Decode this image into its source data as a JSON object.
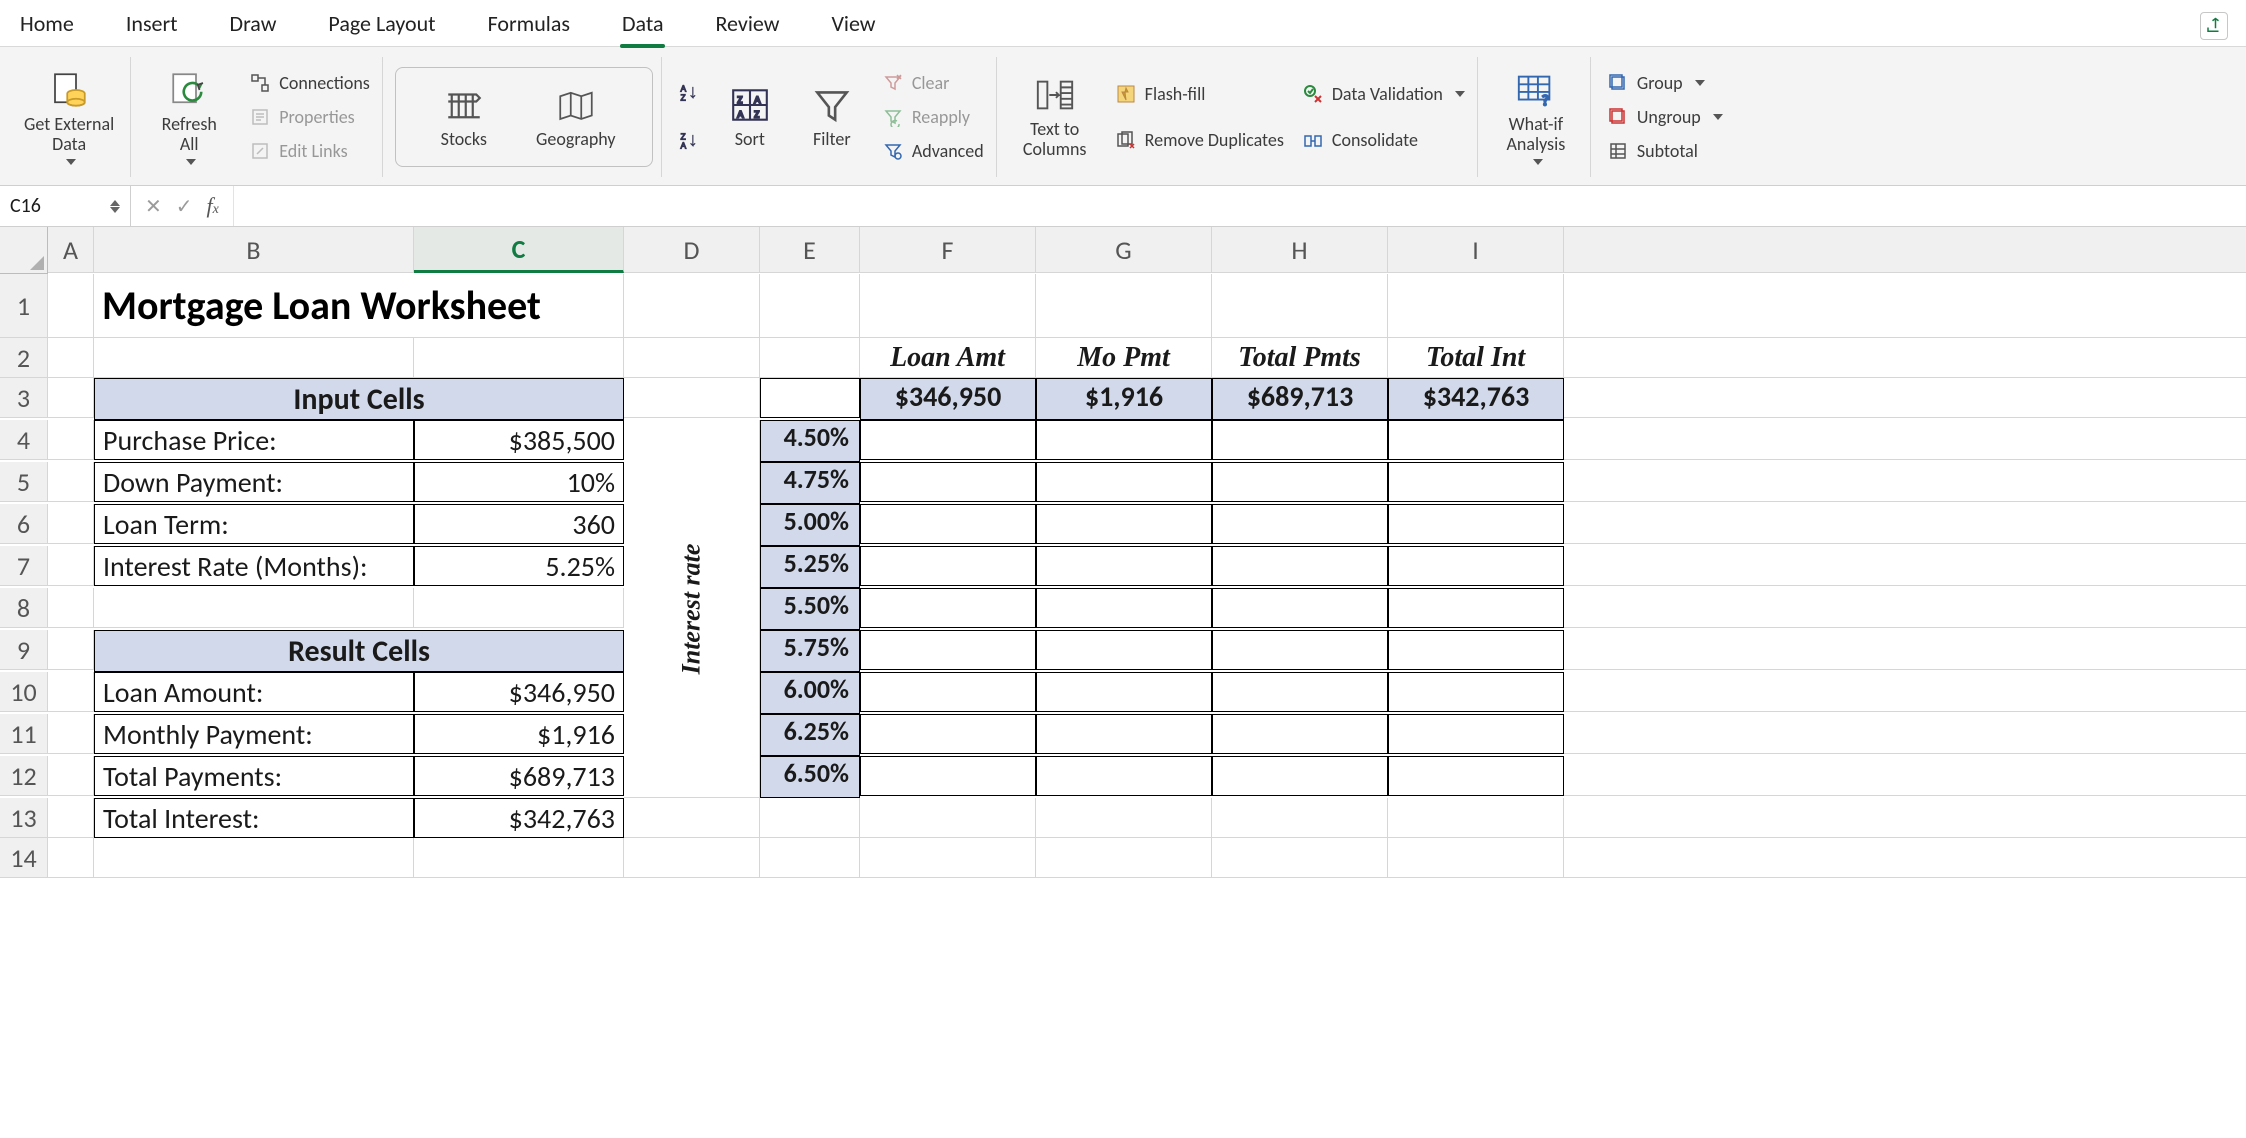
{
  "tabs": {
    "items": [
      "Home",
      "Insert",
      "Draw",
      "Page Layout",
      "Formulas",
      "Data",
      "Review",
      "View"
    ],
    "active_index": 5
  },
  "ribbon": {
    "get_external_data": "Get External\nData",
    "refresh_all": "Refresh\nAll",
    "connections": "Connections",
    "properties": "Properties",
    "edit_links": "Edit Links",
    "stocks": "Stocks",
    "geography": "Geography",
    "sort": "Sort",
    "filter": "Filter",
    "clear": "Clear",
    "reapply": "Reapply",
    "advanced": "Advanced",
    "text_to_columns": "Text to\nColumns",
    "flash_fill": "Flash-fill",
    "remove_duplicates": "Remove Duplicates",
    "data_validation": "Data Validation",
    "consolidate": "Consolidate",
    "what_if": "What-if\nAnalysis",
    "group": "Group",
    "ungroup": "Ungroup",
    "subtotal": "Subtotal"
  },
  "formula_bar": {
    "namebox": "C16",
    "formula": ""
  },
  "columns": [
    "A",
    "B",
    "C",
    "D",
    "E",
    "F",
    "G",
    "H",
    "I"
  ],
  "rows": [
    "1",
    "2",
    "3",
    "4",
    "5",
    "6",
    "7",
    "8",
    "9",
    "10",
    "11",
    "12",
    "13",
    "14"
  ],
  "sheet": {
    "title": "Mortgage Loan Worksheet",
    "input_header": "Input Cells",
    "result_header": "Result Cells",
    "inputs": {
      "purchase_price_lbl": "Purchase Price:",
      "purchase_price": "$385,500",
      "down_payment_lbl": "Down Payment:",
      "down_payment": "10%",
      "loan_term_lbl": "Loan Term:",
      "loan_term": "360",
      "interest_rate_lbl": "Interest Rate (Months):",
      "interest_rate": "5.25%"
    },
    "results": {
      "loan_amount_lbl": "Loan Amount:",
      "loan_amount": "$346,950",
      "monthly_payment_lbl": "Monthly Payment:",
      "monthly_payment": "$1,916",
      "total_payments_lbl": "Total Payments:",
      "total_payments": "$689,713",
      "total_interest_lbl": "Total Interest:",
      "total_interest": "$342,763"
    },
    "datatable": {
      "rotated_label": "Interest rate",
      "col_heads": {
        "loan_amt": "Loan Amt",
        "mo_pmt": "Mo Pmt",
        "total_pmts": "Total Pmts",
        "total_int": "Total Int"
      },
      "row_head_values": {
        "loan_amt": "$346,950",
        "mo_pmt": "$1,916",
        "total_pmts": "$689,713",
        "total_int": "$342,763"
      },
      "rates": [
        "4.50%",
        "4.75%",
        "5.00%",
        "5.25%",
        "5.50%",
        "5.75%",
        "6.00%",
        "6.25%",
        "6.50%"
      ]
    }
  }
}
